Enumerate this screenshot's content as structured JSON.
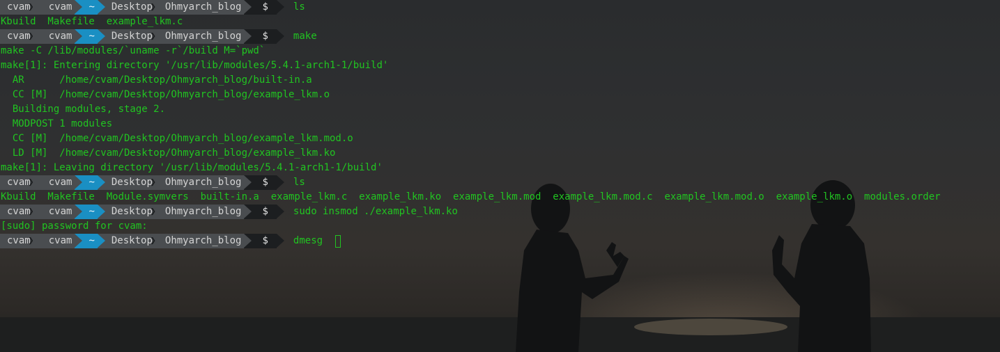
{
  "prompt": {
    "user": "cvam",
    "host": "cvam",
    "home": "~",
    "dir1": "Desktop",
    "dir2": "Ohmyarch_blog",
    "symbol": "$"
  },
  "lines": [
    {
      "type": "prompt",
      "command": "ls"
    },
    {
      "type": "output",
      "text": "Kbuild  Makefile  example_lkm.c"
    },
    {
      "type": "prompt",
      "command": "make"
    },
    {
      "type": "output",
      "text": "make -C /lib/modules/`uname -r`/build M=`pwd`"
    },
    {
      "type": "output",
      "text": "make[1]: Entering directory '/usr/lib/modules/5.4.1-arch1-1/build'"
    },
    {
      "type": "output",
      "text": "  AR      /home/cvam/Desktop/Ohmyarch_blog/built-in.a"
    },
    {
      "type": "output",
      "text": "  CC [M]  /home/cvam/Desktop/Ohmyarch_blog/example_lkm.o"
    },
    {
      "type": "output",
      "text": "  Building modules, stage 2."
    },
    {
      "type": "output",
      "text": "  MODPOST 1 modules"
    },
    {
      "type": "output",
      "text": "  CC [M]  /home/cvam/Desktop/Ohmyarch_blog/example_lkm.mod.o"
    },
    {
      "type": "output",
      "text": "  LD [M]  /home/cvam/Desktop/Ohmyarch_blog/example_lkm.ko"
    },
    {
      "type": "output",
      "text": "make[1]: Leaving directory '/usr/lib/modules/5.4.1-arch1-1/build'"
    },
    {
      "type": "prompt",
      "command": "ls"
    },
    {
      "type": "output",
      "text": "Kbuild  Makefile  Module.symvers  built-in.a  example_lkm.c  example_lkm.ko  example_lkm.mod  example_lkm.mod.c  example_lkm.mod.o  example_lkm.o  modules.order"
    },
    {
      "type": "prompt",
      "command": "sudo insmod ./example_lkm.ko"
    },
    {
      "type": "output",
      "text": "[sudo] password for cvam:"
    },
    {
      "type": "prompt",
      "command": "dmesg",
      "cursor": true
    }
  ],
  "colors": {
    "output_green": "#21c421",
    "segment_grey": "#4a4d50",
    "segment_blue": "#1a8fc3",
    "segment_dark": "#1c1e20"
  },
  "icons": {
    "background": "sunset-silhouette-wallpaper",
    "cursor": "block-cursor-icon"
  }
}
